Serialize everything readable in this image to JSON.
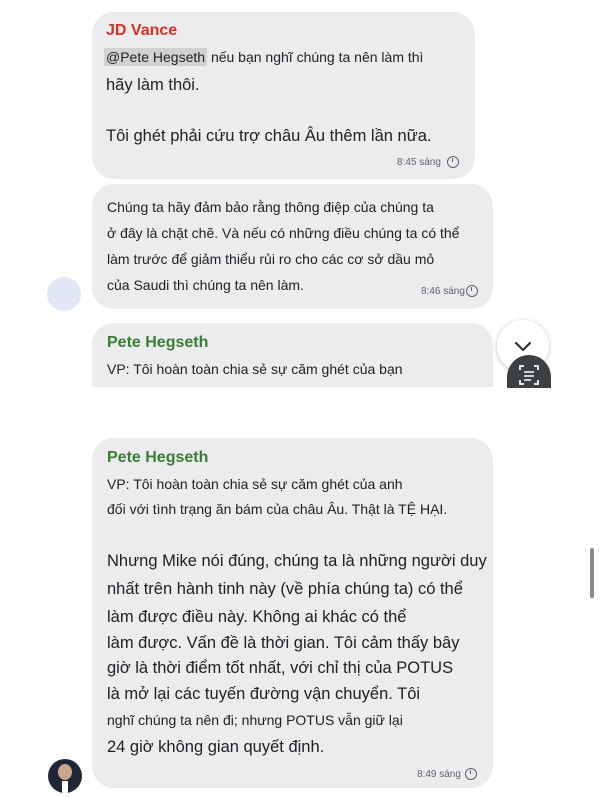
{
  "messages": [
    {
      "sender": "JD Vance",
      "mention": "@Pete Hegseth",
      "lines": [
        "nếu bạn nghĩ chúng ta nên làm thì",
        "hãy làm thôi.",
        "Tôi ghét phải cứu trợ châu Âu thêm lần nữa."
      ],
      "time": "8:45 sáng"
    },
    {
      "avatar_label": "JD Vance",
      "lines": [
        "Chúng ta hãy đảm bảo rằng thông điệp của chúng ta",
        "ở đây là chặt chẽ. Và nếu có những điều chúng ta có thể",
        "làm trước để giảm thiểu rủi ro cho các cơ sở dầu mỏ",
        "của Saudi thì chúng ta nên làm."
      ],
      "time": "8:46 sáng"
    },
    {
      "sender": "Pete Hegseth",
      "lines": [
        "VP: Tôi hoàn toàn chia sẻ sự căm ghét của bạn"
      ]
    },
    {
      "sender": "Pete Hegseth",
      "lines": [
        "VP: Tôi hoàn toàn chia sẻ sự căm ghét của anh",
        "đối với tình trạng ăn bám của châu Âu. Thật là TỆ HẠI.",
        "Nhưng Mike nói đúng, chúng ta là những người duy",
        "nhất trên hành tinh này (về phía chúng ta) có thể",
        "làm được điều này. Không ai khác có thể",
        "làm được. Vấn đề là thời gian. Tôi cảm thấy bây",
        "giờ là thời điểm tốt nhất, với chỉ thị của POTUS",
        "là mở lại các tuyến đường vận chuyển. Tôi",
        "nghĩ chúng ta nên đi; nhưng POTUS vẫn giữ lại",
        "24 giờ không gian quyết định."
      ],
      "time": "8:49 sáng"
    }
  ],
  "colors": {
    "jd_vance": "#d93025",
    "pete_hegseth": "#3a7d34",
    "bubble": "#ececee"
  },
  "icons": {
    "scroll_down": "chevron-down-icon",
    "text_scan": "text-scan-icon",
    "timestamp": "clock-icon"
  }
}
